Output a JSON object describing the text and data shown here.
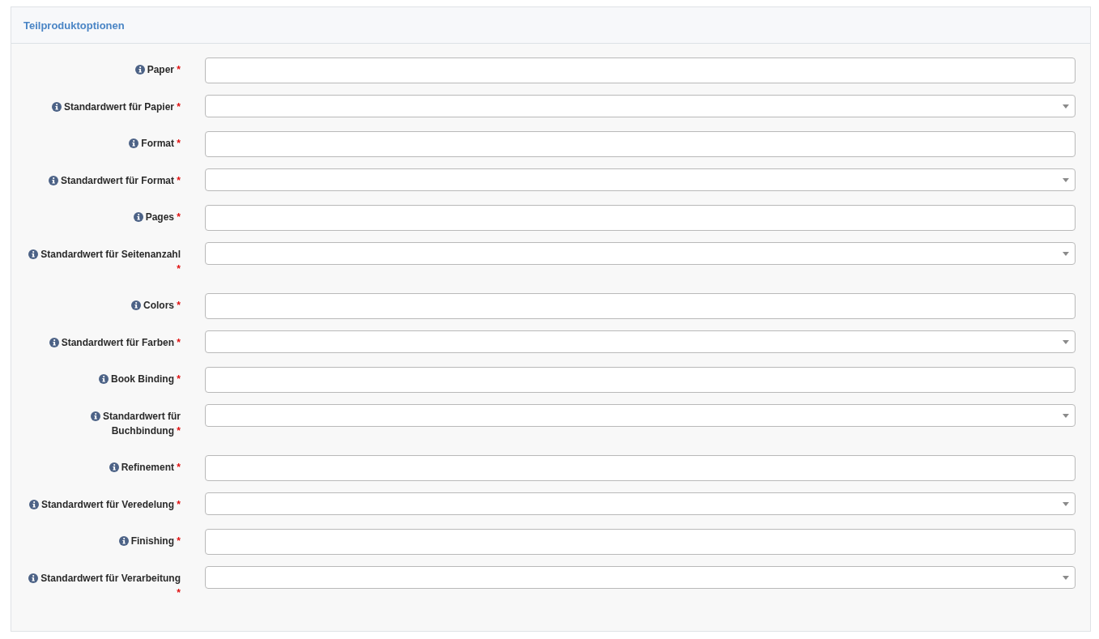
{
  "panel": {
    "title": "Teilproduktoptionen",
    "fields": [
      {
        "kind": "text",
        "label": "Paper",
        "required_mark": "*"
      },
      {
        "kind": "select",
        "label": "Standardwert für Papier",
        "required_mark": "*"
      },
      {
        "kind": "text",
        "label": "Format",
        "required_mark": "*"
      },
      {
        "kind": "select",
        "label": "Standardwert für Format",
        "required_mark": "*"
      },
      {
        "kind": "text",
        "label": "Pages",
        "required_mark": "*"
      },
      {
        "kind": "select",
        "label": "Standardwert für Seitenanzahl",
        "required_mark": "*"
      },
      {
        "kind": "text",
        "label": "Colors",
        "required_mark": "*"
      },
      {
        "kind": "select",
        "label": "Standardwert für Farben",
        "required_mark": "*"
      },
      {
        "kind": "text",
        "label": "Book Binding",
        "required_mark": "*"
      },
      {
        "kind": "select",
        "label": "Standardwert für Buchbindung",
        "required_mark": "*"
      },
      {
        "kind": "text",
        "label": "Refinement",
        "required_mark": "*"
      },
      {
        "kind": "select",
        "label": "Standardwert für Veredelung",
        "required_mark": "*"
      },
      {
        "kind": "text",
        "label": "Finishing",
        "required_mark": "*"
      },
      {
        "kind": "select",
        "label": "Standardwert für Verarbeitung",
        "required_mark": "*"
      }
    ]
  }
}
